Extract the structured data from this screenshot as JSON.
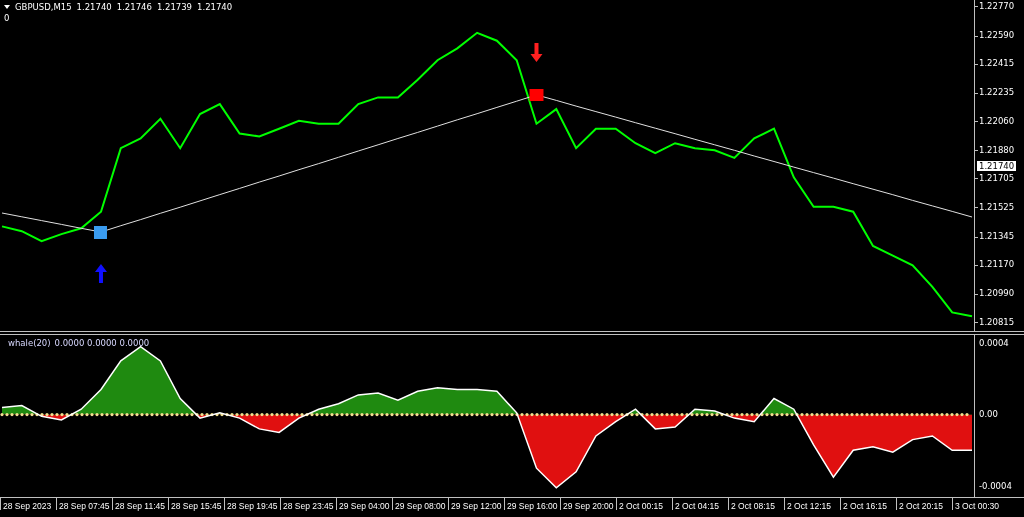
{
  "header": {
    "quotes": [
      "1.21740",
      "1.21746",
      "1.21739",
      "1.21740"
    ],
    "line_2": "0"
  },
  "price_chart": {
    "current_price": "1.21740",
    "chart_data": {
      "type": "line",
      "ylim": [
        1.2076,
        1.2281
      ],
      "yticks": [
        {
          "value": 1.2277,
          "label": "1.22770"
        },
        {
          "value": 1.2259,
          "label": "1.22590"
        },
        {
          "value": 1.22415,
          "label": "1.22415"
        },
        {
          "value": 1.22235,
          "label": "1.22235"
        },
        {
          "value": 1.2206,
          "label": "1.22060"
        },
        {
          "value": 1.2188,
          "label": "1.21880"
        },
        {
          "value": 1.21705,
          "label": "1.21705"
        },
        {
          "value": 1.21525,
          "label": "1.21525"
        },
        {
          "value": 1.21345,
          "label": "1.21345"
        },
        {
          "value": 1.2117,
          "label": "1.21170"
        },
        {
          "value": 1.2099,
          "label": "1.20990"
        },
        {
          "value": 1.20815,
          "label": "1.20815"
        }
      ],
      "series": [
        {
          "name": "GBPUSD,M15",
          "color": "#00ff00",
          "values": [
            1.21408,
            1.21378,
            1.21317,
            1.2136,
            1.21396,
            1.21499,
            1.21892,
            1.21953,
            1.22074,
            1.21892,
            1.22104,
            1.22165,
            1.21983,
            1.21965,
            1.22013,
            1.22062,
            1.22044,
            1.22044,
            1.22165,
            1.22207,
            1.22207,
            1.22316,
            1.22437,
            1.2251,
            1.22607,
            1.22558,
            1.22437,
            1.22044,
            1.22134,
            1.21892,
            1.22013,
            1.22013,
            1.21923,
            1.21862,
            1.21923,
            1.21892,
            1.2188,
            1.21832,
            1.21953,
            1.22013,
            1.21711,
            1.21529,
            1.21529,
            1.21499,
            1.21287,
            1.21227,
            1.21166,
            1.21033,
            1.20875,
            1.20851
          ]
        },
        {
          "color": "#e0e0e0",
          "values": [
            1.21491,
            1.21467,
            1.21444,
            1.2142,
            1.21396,
            1.21373,
            1.21412,
            1.2145,
            1.21489,
            1.21527,
            1.21566,
            1.21605,
            1.21643,
            1.21682,
            1.2172,
            1.21759,
            1.21797,
            1.21836,
            1.21875,
            1.21913,
            1.21952,
            1.2199,
            1.22029,
            1.22068,
            1.22106,
            1.22145,
            1.22183,
            1.22222,
            1.22188,
            1.22153,
            1.22119,
            1.22085,
            1.2205,
            1.22016,
            1.21982,
            1.21947,
            1.21913,
            1.21879,
            1.21844,
            1.2181,
            1.21775,
            1.21741,
            1.21707,
            1.21672,
            1.21638,
            1.21604,
            1.21569,
            1.21535,
            1.21501,
            1.21466
          ]
        }
      ]
    }
  },
  "indicator": {
    "label_values": "0.0000 0.0000 0.0000",
    "chart_data": {
      "type": "area",
      "ylim": [
        -0.00045,
        0.000445
      ],
      "yticks": [
        {
          "value": 0.0004,
          "label": "0.0004"
        },
        {
          "value": 0,
          "label": "0.00"
        },
        {
          "value": -0.0004,
          "label": "-0.0004"
        }
      ],
      "series": [
        {
          "name": "whale(20)",
          "color": "#ffffff",
          "values": [
            4e-05,
            5e-05,
            -1e-05,
            -3e-05,
            3e-05,
            0.00014,
            0.0003,
            0.00038,
            0.0003,
            9e-05,
            -2e-05,
            1e-05,
            -2e-05,
            -8e-05,
            -0.0001,
            -2e-05,
            3e-05,
            6e-05,
            0.00011,
            0.00012,
            8e-05,
            0.00013,
            0.00015,
            0.00014,
            0.00014,
            0.00013,
            1e-05,
            -0.0003,
            -0.00041,
            -0.00032,
            -0.00012,
            -4e-05,
            3e-05,
            -8e-05,
            -7e-05,
            3e-05,
            2e-05,
            -2e-05,
            -4e-05,
            9e-05,
            3e-05,
            -0.00017,
            -0.00035,
            -0.0002,
            -0.00018,
            -0.00021,
            -0.00014,
            -0.00012,
            -0.0002,
            -0.0002
          ]
        }
      ]
    }
  },
  "time_axis": [
    "28 Sep 2023",
    "28 Sep 07:45",
    "28 Sep 11:45",
    "28 Sep 15:45",
    "28 Sep 19:45",
    "28 Sep 23:45",
    "29 Sep 04:00",
    "29 Sep 08:00",
    "29 Sep 12:00",
    "29 Sep 16:00",
    "29 Sep 20:00",
    "2 Oct 00:15",
    "2 Oct 04:15",
    "2 Oct 08:15",
    "2 Oct 12:15",
    "2 Oct 16:15",
    "2 Oct 20:15",
    "3 Oct 00:30"
  ]
}
